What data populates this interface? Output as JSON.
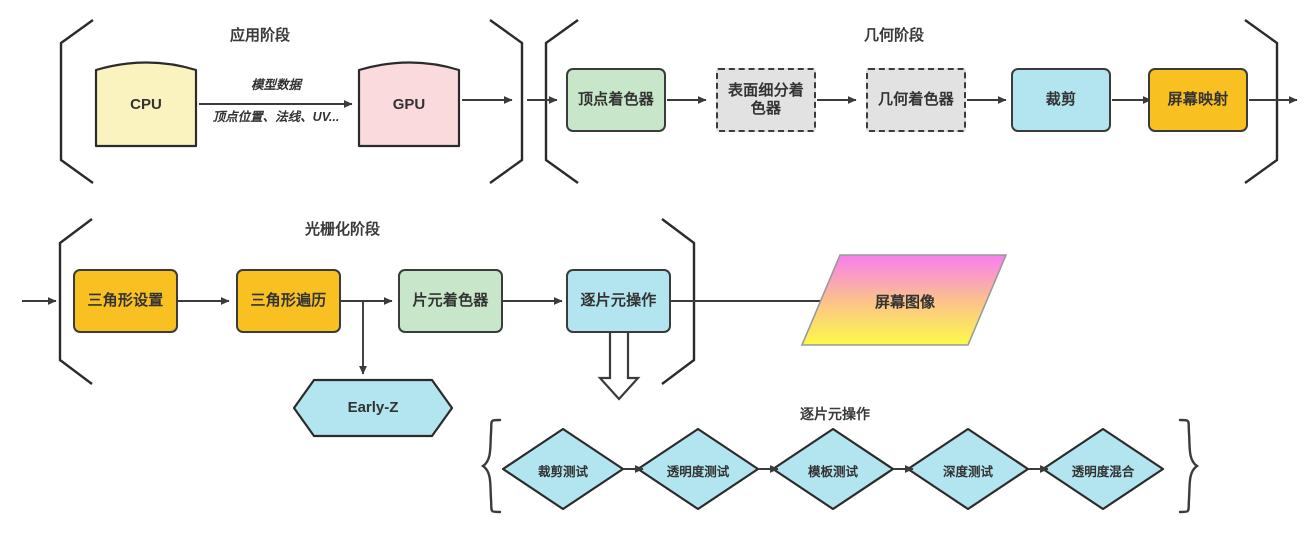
{
  "diagram": {
    "title_app": "应用阶段",
    "title_geom": "几何阶段",
    "title_raster": "光栅化阶段",
    "title_perfrag": "逐片元操作"
  },
  "colors": {
    "yellow": "#faf3c0",
    "pink": "#fadadd",
    "green": "#c8e6c9",
    "gray": "#e2e2e2",
    "cyan": "#b3e5f0",
    "orange": "#f9c022",
    "stroke": "#3b3b3b",
    "text": "#333333",
    "gradient_top": "#f87ef0",
    "gradient_bottom": "#fdfa4a"
  },
  "application_stage": {
    "nodes": [
      {
        "id": "cpu",
        "label": "CPU",
        "shape": "curved-top-box",
        "fill": "#faf3c0"
      },
      {
        "id": "gpu",
        "label": "GPU",
        "shape": "curved-top-box",
        "fill": "#fadadd"
      }
    ],
    "edge_label_top": "模型数据",
    "edge_label_bottom": "顶点位置、法线、UV..."
  },
  "geometry_stage": {
    "nodes": [
      {
        "id": "vertex-shader",
        "label": "顶点着色器",
        "shape": "rect",
        "fill": "#c8e6c9",
        "dashed": false
      },
      {
        "id": "tessellation-shader",
        "label": "表面细分着色器",
        "shape": "rect",
        "fill": "#e2e2e2",
        "dashed": true
      },
      {
        "id": "geometry-shader",
        "label": "几何着色器",
        "shape": "rect",
        "fill": "#e2e2e2",
        "dashed": true
      },
      {
        "id": "clipping",
        "label": "裁剪",
        "shape": "rect",
        "fill": "#b3e5f0",
        "dashed": false
      },
      {
        "id": "screen-mapping",
        "label": "屏幕映射",
        "shape": "rect",
        "fill": "#f9c022",
        "dashed": false
      }
    ]
  },
  "rasterization_stage": {
    "nodes": [
      {
        "id": "triangle-setup",
        "label": "三角形设置",
        "shape": "rect",
        "fill": "#f9c022"
      },
      {
        "id": "triangle-traversal",
        "label": "三角形遍历",
        "shape": "rect",
        "fill": "#f9c022"
      },
      {
        "id": "fragment-shader",
        "label": "片元着色器",
        "shape": "rect",
        "fill": "#c8e6c9"
      },
      {
        "id": "per-fragment-op",
        "label": "逐片元操作",
        "shape": "rect",
        "fill": "#b3e5f0"
      }
    ],
    "branch_node": {
      "id": "early-z",
      "label": "Early-Z",
      "shape": "hexagon",
      "fill": "#b3e5f0"
    },
    "output_node": {
      "id": "screen-image",
      "label": "屏幕图像",
      "shape": "parallelogram",
      "fill": "gradient"
    }
  },
  "per_fragment_operations": {
    "title": "逐片元操作",
    "tests": [
      {
        "id": "scissor-test",
        "label": "裁剪测试"
      },
      {
        "id": "alpha-test",
        "label": "透明度测试"
      },
      {
        "id": "stencil-test",
        "label": "模板测试"
      },
      {
        "id": "depth-test",
        "label": "深度测试"
      },
      {
        "id": "alpha-blend",
        "label": "透明度混合"
      }
    ]
  }
}
